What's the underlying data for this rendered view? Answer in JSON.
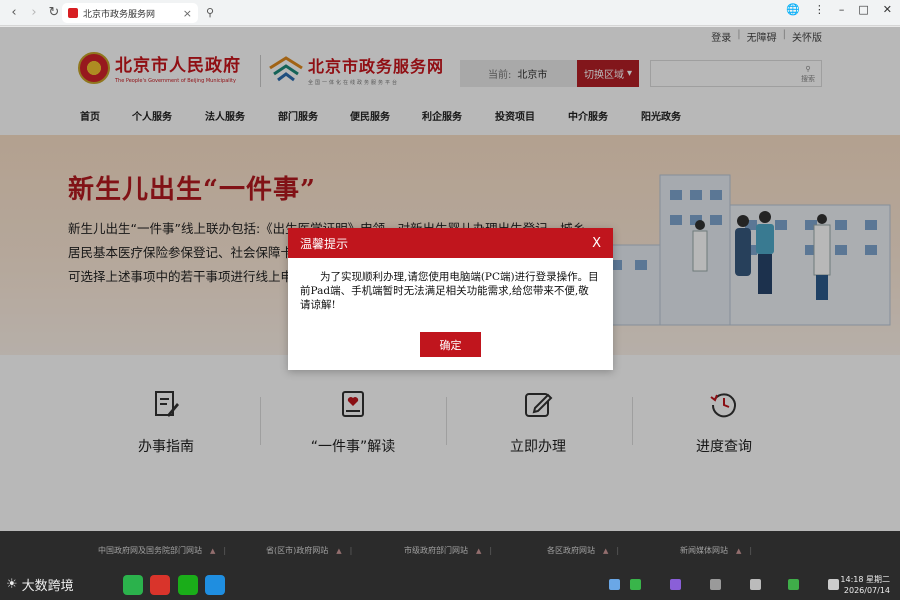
{
  "browser": {
    "tab_title": "北京市政务服务网",
    "tab_close": "×"
  },
  "header": {
    "util_links": [
      "登录",
      "无障碍",
      "关怀版"
    ],
    "util_sep": "|",
    "gov_name": "北京市人民政府",
    "gov_en": "The People's Government of Beijing Municipality",
    "service_name": "北京市政务服务网",
    "service_slogan": "全国一体化在线政务服务平台",
    "location_label": "当前:",
    "location_city": "北京市",
    "switch_region": "切换区域",
    "search_btn": "搜索"
  },
  "nav": [
    "首页",
    "个人服务",
    "法人服务",
    "部门服务",
    "便民服务",
    "利企服务",
    "投资项目",
    "中介服务",
    "阳光政务"
  ],
  "hero": {
    "title": "新生儿出生“一件事”",
    "desc": "新生儿出生“一件事”线上联办包括:《出生医学证明》申领、对新出生婴儿办理出生登记、城乡居民基本医疗保险参保登记、社会保障卡申领……按照上述顺序依次进行办理。新生儿父母也可选择上述事项中的若干事项进行线上申领(单办)。"
  },
  "features": [
    {
      "label": "办事指南",
      "icon": "document-edit-icon"
    },
    {
      "label": "“一件事”解读",
      "icon": "book-heart-icon"
    },
    {
      "label": "立即办理",
      "icon": "pencil-square-icon"
    },
    {
      "label": "进度查询",
      "icon": "history-clock-icon"
    }
  ],
  "footer_links": [
    "中国政府网及国务院部门网站",
    "省(区市)政府网站",
    "市级政府部门网站",
    "各区政府网站",
    "新闻媒体网站"
  ],
  "modal": {
    "title": "温馨提示",
    "close": "X",
    "message": "为了实现顺利办理,请您使用电脑端(PC端)进行登录操作。目前Pad端、手机端暂时无法满足相关功能需求,给您带来不便,敬请谅解!",
    "ok": "确定"
  },
  "taskbar": {
    "weather_text": "大数跨境",
    "time": "14:18 星期二",
    "date": "2026/07/14"
  },
  "colors": {
    "brand_red": "#c0151d",
    "footer_bg": "#3c3c3c",
    "taskbar_bg": "#2b2b2b"
  }
}
